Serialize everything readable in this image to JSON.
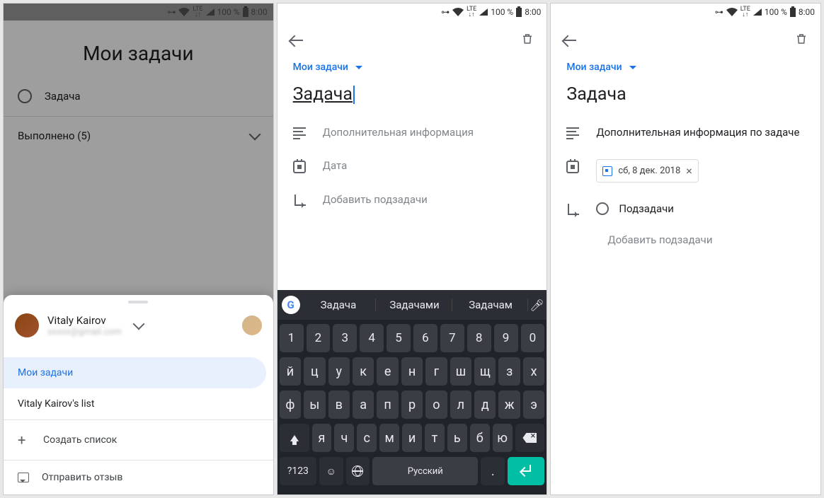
{
  "status": {
    "network": "LTE",
    "battery_pct": "100 %",
    "time": "8:00"
  },
  "s1": {
    "title": "Мои задачи",
    "task": "Задача",
    "completed": "Выполнено (5)",
    "account_name": "Vitaly Kairov",
    "list_selected": "Мои задачи",
    "list_other": "Vitaly Kairov's list",
    "create_list": "Создать список",
    "feedback": "Отправить отзыв"
  },
  "s2": {
    "list_name": "Мои задачи",
    "task_title": "Задача",
    "notes_ph": "Дополнительная информация",
    "date_ph": "Дата",
    "subtask_ph": "Добавить подзадачи",
    "suggestions": [
      "Задача",
      "Задачами",
      "Задачам"
    ],
    "kb_rows": {
      "nums": [
        "1",
        "2",
        "3",
        "4",
        "5",
        "6",
        "7",
        "8",
        "9",
        "0"
      ],
      "r1": [
        "й",
        "ц",
        "у",
        "к",
        "е",
        "н",
        "г",
        "ш",
        "щ",
        "з",
        "х"
      ],
      "r2": [
        "ф",
        "ы",
        "в",
        "а",
        "п",
        "р",
        "о",
        "л",
        "д",
        "ж",
        "э"
      ],
      "r3": [
        "я",
        "ч",
        "с",
        "м",
        "и",
        "т",
        "ь",
        "б",
        "ю"
      ]
    },
    "kb_sym": "?123",
    "kb_lang": "Русский"
  },
  "s3": {
    "list_name": "Мои задачи",
    "task_title": "Задача",
    "notes": "Дополнительная информация по задаче",
    "date": "сб, 8 дек. 2018",
    "subtask": "Подзадачи",
    "add_sub": "Добавить подзадачи"
  }
}
